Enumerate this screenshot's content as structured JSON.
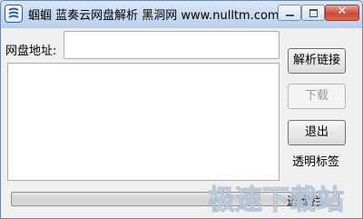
{
  "window": {
    "title": "蝈蝈 蓝奏云网盘解析   黑洞网 www.nulltm.com",
    "close_glyph": "✕"
  },
  "form": {
    "url_label": "网盘地址:",
    "url_value": "",
    "result_text": ""
  },
  "buttons": {
    "parse": "解析链接",
    "download": "下载",
    "exit": "退出"
  },
  "transparent_label": "透明标签",
  "progress": {
    "value": 0,
    "text": "进度栏"
  },
  "watermark": {
    "text": "极速下载站"
  },
  "colors": {
    "title_gradient_top": "#d9e7f7",
    "close_button": "#c84a36",
    "client_bg": "#f0f0f0"
  }
}
